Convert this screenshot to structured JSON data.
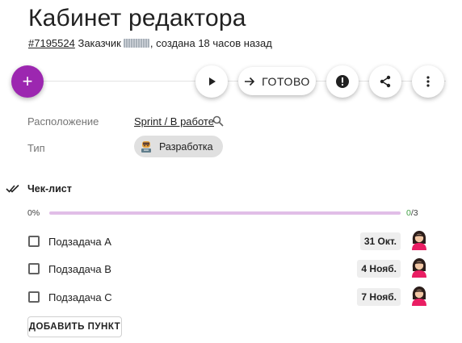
{
  "header": {
    "title": "Кабинет редактора",
    "task_id": "#7195524",
    "customer_prefix": "Заказчик",
    "created_suffix": ", создана 18 часов назад"
  },
  "toolbar": {
    "add_label": "+",
    "done_label": "ГОТОВО",
    "icons": [
      "play-icon",
      "arrow-right-icon",
      "alert-icon",
      "share-icon",
      "more-vert-icon"
    ]
  },
  "fields": {
    "location_label": "Расположение",
    "location_value": "Sprint / В работе",
    "type_label": "Тип",
    "type_value": "Разработка"
  },
  "checklist": {
    "title": "Чек-лист",
    "progress_percent_label": "0%",
    "progress_fraction": 0,
    "completed_count": "0",
    "total_suffix": "/3",
    "items": [
      {
        "label": "Подзадача A",
        "date": "31 Окт."
      },
      {
        "label": "Подзадача B",
        "date": "4 Нояб."
      },
      {
        "label": "Подзадача C",
        "date": "7 Нояб."
      }
    ],
    "add_item_label": "ДОБАВИТЬ ПУНКТ"
  },
  "colors": {
    "accent": "#9c27b0",
    "progress_track": "#e1bee7",
    "done_count": "#43a047"
  }
}
